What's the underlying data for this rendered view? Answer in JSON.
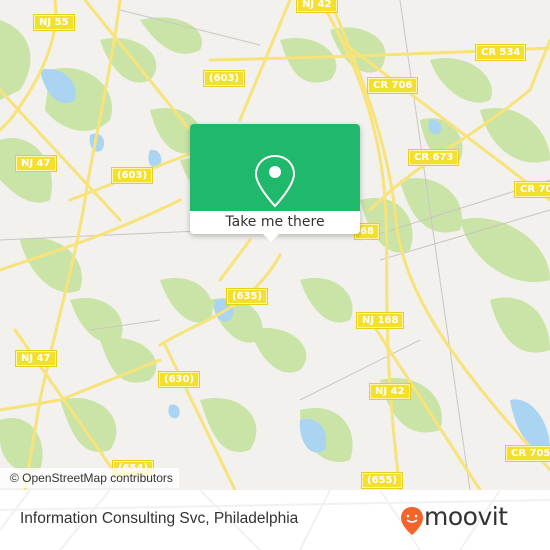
{
  "map": {
    "attribution": "© OpenStreetMap contributors",
    "colors": {
      "background": "#f2f1ed",
      "forest": "#c9e4a6",
      "water": "#a9d4f2",
      "road": "#f7e37a",
      "road_label_bg": "#f5df2e",
      "popup_green": "#20b86a"
    },
    "road_labels": [
      {
        "id": "nj55",
        "text": "NJ 55"
      },
      {
        "id": "nj42-top",
        "text": "NJ 42"
      },
      {
        "id": "603-top",
        "text": "(603)"
      },
      {
        "id": "cr534",
        "text": "CR 534"
      },
      {
        "id": "cr706",
        "text": "CR 706"
      },
      {
        "id": "nj47-top",
        "text": "NJ 47"
      },
      {
        "id": "603-mid",
        "text": "(603)"
      },
      {
        "id": "cr673",
        "text": "CR 673"
      },
      {
        "id": "cr70x",
        "text": "CR 70"
      },
      {
        "id": "168-partial",
        "text": "68"
      },
      {
        "id": "635",
        "text": "(635)"
      },
      {
        "id": "nj168",
        "text": "NJ 168"
      },
      {
        "id": "nj47-bot",
        "text": "NJ 47"
      },
      {
        "id": "630",
        "text": "(630)"
      },
      {
        "id": "nj42-bot",
        "text": "NJ 42"
      },
      {
        "id": "cr705",
        "text": "CR 705"
      },
      {
        "id": "654",
        "text": "(654)"
      },
      {
        "id": "655",
        "text": "(655)"
      }
    ]
  },
  "popup": {
    "icon": "map-pin-icon",
    "button_label": "Take me there"
  },
  "footer": {
    "title": "Information Consulting Svc, Philadelphia",
    "brand": "moovit",
    "brand_color": "#f2642a"
  }
}
